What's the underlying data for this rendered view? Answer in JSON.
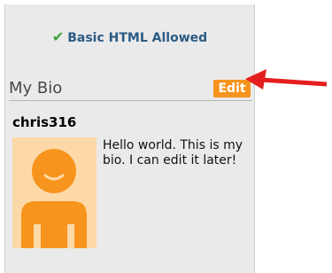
{
  "format_note": {
    "text": "Basic HTML Allowed",
    "icon": "check-icon"
  },
  "bio": {
    "title": "My Bio",
    "edit_label": "Edit",
    "username": "chris316",
    "text": "Hello world. This is my bio. I can edit it later!"
  },
  "colors": {
    "panel_bg": "#eaeaea",
    "edit_button": "#f7941d",
    "avatar_bg": "#fdd9a7",
    "avatar_figure": "#f7941d",
    "note_text": "#2b5b85",
    "check": "#3ca03c",
    "arrow": "#e41e1e"
  }
}
